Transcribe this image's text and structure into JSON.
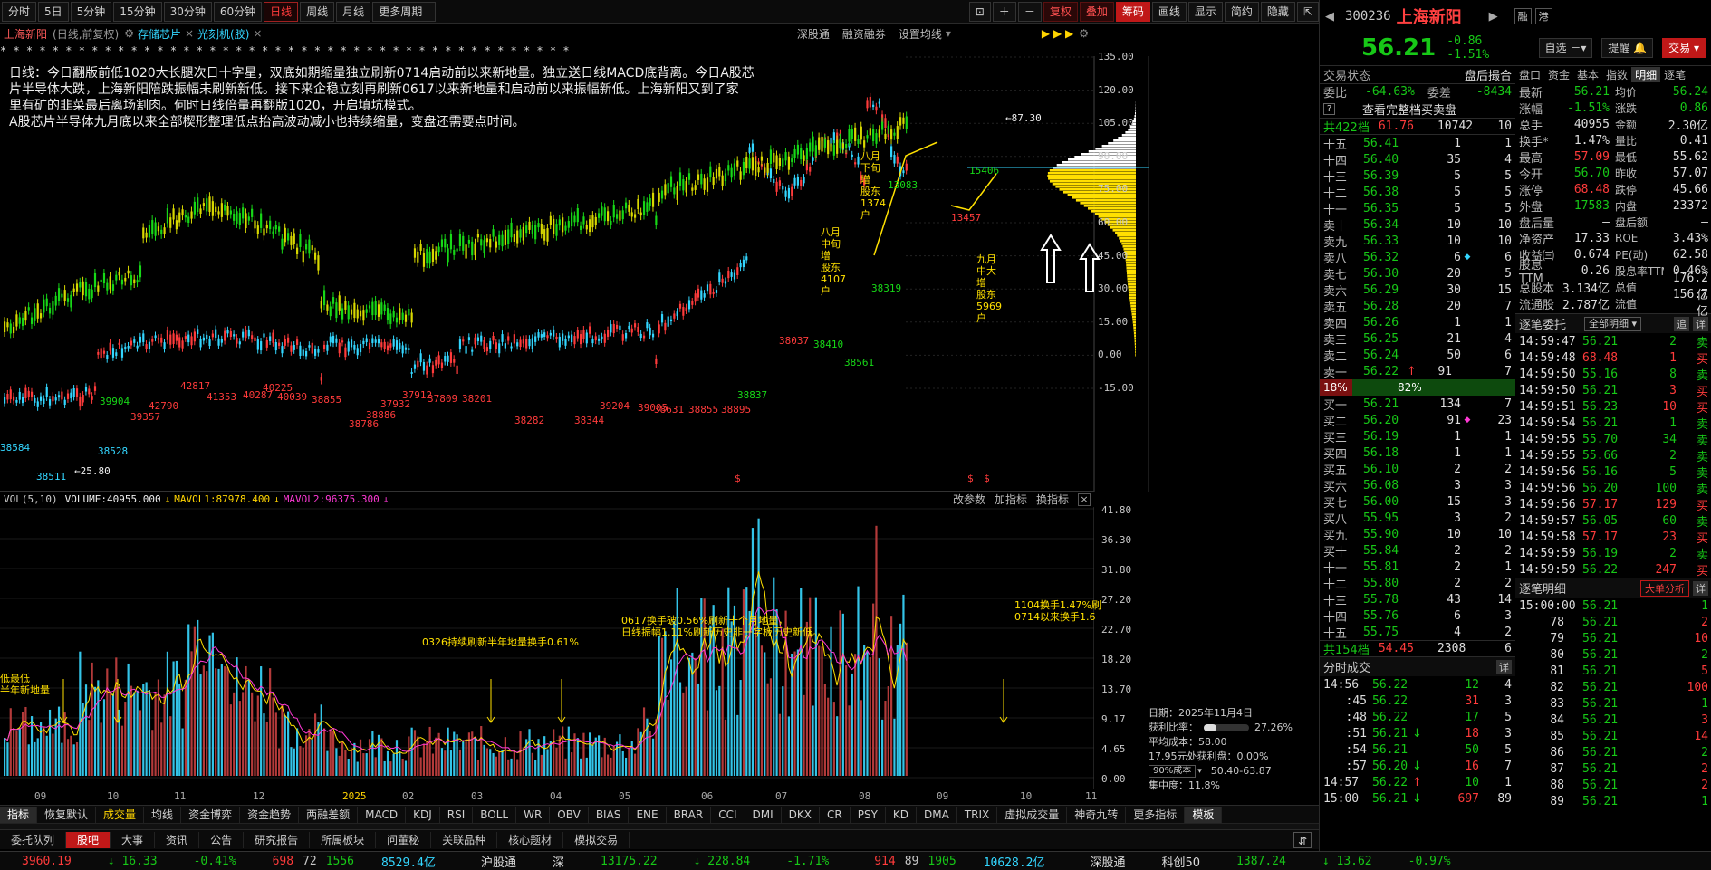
{
  "toolbar": {
    "periods": [
      "分时",
      "5日",
      "5分钟",
      "15分钟",
      "30分钟",
      "60分钟",
      "日线",
      "周线",
      "月线",
      "更多周期"
    ],
    "active_period": "日线",
    "right_buttons": [
      "复权",
      "叠加",
      "筹码",
      "画线",
      "显示",
      "简约",
      "隐藏"
    ]
  },
  "chart_header": {
    "name": "上海新阳",
    "mode": "(日线,前复权)",
    "tag1": "存储芯片",
    "tag2": "光刻机(胶)",
    "links": [
      "深股通",
      "融资融券",
      "设置均线"
    ]
  },
  "stars": "*     *         *         *         *       *       *         *       *       *       *       *      * * * *   *       *         *    * *       *   *  *     * *    *  *   *   *    *       *  *   * *   * *  *    *   *  *    * *   *",
  "annotation": [
    "日线：今日翻版前低1020大长腿次日十字星，双底如期缩量独立刷新0714启动前以来新地量。独立送日线MACD底背离。今日A股芯",
    "片半导体大跌，上海新阳陪跌振幅未刷新新低。接下来企稳立刻再刷新0617以来新地量和启动前以来振幅新低。上海新阳又到了家",
    "里有矿的韭菜最后离场割肉。何时日线倍量再翻版1020，开启填坑模式。",
    "A股芯片半导体九月底以来全部楔形整理低点抬高波动减小也持续缩量，变盘还需要点时间。"
  ],
  "price_axis": [
    "135.00",
    "120.00",
    "105.00",
    "90.00",
    "75.00",
    "60.00",
    "45.00",
    "30.00",
    "15.00",
    "0.00",
    "-15.00"
  ],
  "vol_axis": [
    "41.80",
    "36.30",
    "31.80",
    "27.20",
    "22.70",
    "18.20",
    "13.70",
    "9.17",
    "4.65",
    "0.00"
  ],
  "months": [
    "09",
    "10",
    "11",
    "12",
    "2025",
    "02",
    "03",
    "04",
    "05",
    "06",
    "07",
    "08",
    "09",
    "10",
    "11"
  ],
  "chart_labels": {
    "low_labels": [
      "38584",
      "38528",
      "38511",
      "39357",
      "39904",
      "42790",
      "42817",
      "41353",
      "40287",
      "40225",
      "40039",
      "38855",
      "38786",
      "38886",
      "37932",
      "37912",
      "37809",
      "38201",
      "38282",
      "38344",
      "39204",
      "39005",
      "38631",
      "38855",
      "38895",
      "38837",
      "38037",
      "38410",
      "38561",
      "38319"
    ],
    "low_mark": "←25.80",
    "high_mark": "←87.30",
    "callout1": [
      "八月下旬增",
      "股东1374户"
    ],
    "callout2": [
      "八月中旬增",
      "股东4107户"
    ],
    "callout3": [
      "九月中大增",
      "股东5969户"
    ],
    "callout4": "15406",
    "callout5": "13083",
    "callout6": "13457"
  },
  "vol_header": {
    "label": "VOL(5,10)",
    "volume": "VOLUME:40955.000",
    "mavol1": "MAVOL1:87978.400",
    "mavol2": "MAVOL2:96375.300",
    "links": [
      "改参数",
      "加指标",
      "换指标"
    ]
  },
  "vol_notes": {
    "n1": "0326持续刷新半年地量换手0.61%",
    "n2a": "0617换手破0.56%刷新十个月地量，",
    "n2b": "日线振幅1.11%刷新历史非一字板历史新低。",
    "n3a": "1104换手1.47%刷",
    "n3b": "0714以来换手1.6",
    "n4a": "低最低",
    "n4b": "半年新地量"
  },
  "chip_panel": {
    "date": "日期：2025年11月4日",
    "profit_label": "获利比率：",
    "profit_value": "27.26%",
    "avg": "平均成本：58.00",
    "prof2": "17.95元处获利盘：0.00%",
    "cost_sel": "90%成本",
    "cost_range": "50.40-63.87",
    "conc": "集中度：11.8%"
  },
  "indicator_tabs": [
    "指标",
    "恢复默认",
    "成交量",
    "均线",
    "资金博弈",
    "资金趋势",
    "两融差额",
    "MACD",
    "KDJ",
    "RSI",
    "BOLL",
    "WR",
    "OBV",
    "BIAS",
    "ENE",
    "BRAR",
    "CCI",
    "DMI",
    "DKX",
    "CR",
    "PSY",
    "KD",
    "DMA",
    "TRIX",
    "虚拟成交量",
    "神奇九转",
    "更多指标",
    "模板"
  ],
  "bottom_tabs": [
    "委托队列",
    "股吧",
    "大事",
    "资讯",
    "公告",
    "研究报告",
    "所属板块",
    "问董秘",
    "关联品种",
    "核心题材",
    "模拟交易"
  ],
  "status_bar": {
    "sh_index": "3960.19",
    "sh_chg": "↓ 16.33",
    "sh_pct": "-0.41%",
    "sh_updown": "698",
    "sh_flat": "72",
    "sh_up": "1556",
    "sh_amount": "8529.4亿",
    "hgt": "沪股通",
    "sz_label": "深",
    "sz_index": "13175.22",
    "sz_chg": "↓ 228.84",
    "sz_pct": "-1.71%",
    "sz_updown": "914",
    "sz_flat": "89",
    "sz_up": "1905",
    "sz_amount": "10628.2亿",
    "sgt": "深股通",
    "kc_label": "科创50",
    "kc_index": "1387.24",
    "kc_chg": "↓ 13.62",
    "kc_pct": "-0.97%"
  },
  "quote": {
    "code": "300236",
    "name": "上海新阳",
    "btn1": "融",
    "btn2": "港",
    "price": "56.21",
    "change": "-0.86",
    "pct": "-1.51%",
    "btn_watch": "自选",
    "btn_alert": "提醒",
    "btn_trade": "交易"
  },
  "right_tabs": [
    "盘口",
    "资金",
    "基本",
    "指数",
    "明细",
    "逐笔"
  ],
  "trade_state": "交易状态",
  "after_hours": "盘后撮合",
  "wei": {
    "label": "委比",
    "value": "-64.63%",
    "label2": "委差",
    "value2": "-8434"
  },
  "full_queue_btn": "查看完整档买卖盘",
  "total_sell": {
    "label": "共422档",
    "price": "61.76",
    "vol": "10742",
    "n": "10"
  },
  "sells": [
    [
      "十五",
      "56.41",
      "1",
      "1"
    ],
    [
      "十四",
      "56.40",
      "35",
      "4"
    ],
    [
      "十三",
      "56.39",
      "5",
      "5"
    ],
    [
      "十二",
      "56.38",
      "5",
      "5"
    ],
    [
      "十一",
      "56.35",
      "5",
      "5"
    ],
    [
      "卖十",
      "56.34",
      "10",
      "10"
    ],
    [
      "卖九",
      "56.33",
      "10",
      "10"
    ],
    [
      "卖八",
      "56.32",
      "6",
      "6"
    ],
    [
      "卖七",
      "56.30",
      "20",
      "5"
    ],
    [
      "卖六",
      "56.29",
      "30",
      "15"
    ],
    [
      "卖五",
      "56.28",
      "20",
      "7"
    ],
    [
      "卖四",
      "56.26",
      "1",
      "1"
    ],
    [
      "卖三",
      "56.25",
      "21",
      "4"
    ],
    [
      "卖二",
      "56.24",
      "50",
      "6"
    ],
    [
      "卖一",
      "56.22",
      "91",
      "7"
    ]
  ],
  "ratio": {
    "left": "18%",
    "right": "82%"
  },
  "buys": [
    [
      "买一",
      "56.21",
      "134",
      "7"
    ],
    [
      "买二",
      "56.20",
      "91",
      "23"
    ],
    [
      "买三",
      "56.19",
      "1",
      "1"
    ],
    [
      "买四",
      "56.18",
      "1",
      "1"
    ],
    [
      "买五",
      "56.10",
      "2",
      "2"
    ],
    [
      "买六",
      "56.08",
      "3",
      "3"
    ],
    [
      "买七",
      "56.00",
      "15",
      "3"
    ],
    [
      "买八",
      "55.95",
      "3",
      "2"
    ],
    [
      "买九",
      "55.90",
      "10",
      "10"
    ],
    [
      "买十",
      "55.84",
      "2",
      "2"
    ],
    [
      "十一",
      "55.81",
      "2",
      "1"
    ],
    [
      "十二",
      "55.80",
      "2",
      "2"
    ],
    [
      "十三",
      "55.78",
      "43",
      "14"
    ],
    [
      "十四",
      "55.76",
      "6",
      "3"
    ],
    [
      "十五",
      "55.75",
      "4",
      "2"
    ]
  ],
  "total_buy": {
    "label": "共154档",
    "price": "54.45",
    "vol": "2308",
    "n": "6"
  },
  "stats": [
    [
      "最新",
      "56.21",
      "均价",
      "56.24"
    ],
    [
      "涨幅",
      "-1.51%",
      "涨跌",
      "0.86"
    ],
    [
      "总手",
      "40955",
      "金额",
      "2.30亿"
    ],
    [
      "换手*",
      "1.47%",
      "量比",
      "0.41"
    ],
    [
      "最高",
      "57.09",
      "最低",
      "55.62"
    ],
    [
      "今开",
      "56.70",
      "昨收",
      "57.07"
    ],
    [
      "涨停",
      "68.48",
      "跌停",
      "45.66"
    ],
    [
      "外盘",
      "17583",
      "内盘",
      "23372"
    ],
    [
      "盘后量",
      "—",
      "盘后额",
      "—"
    ],
    [
      "净资产",
      "17.33",
      "ROE",
      "3.43%"
    ],
    [
      "收益㈢",
      "0.674",
      "PE(动)",
      "62.58"
    ],
    [
      "股息TTM",
      "0.26",
      "股息率TTM",
      "0.46%"
    ],
    [
      "总股本",
      "3.134亿",
      "总值",
      "176.2亿"
    ],
    [
      "流通股",
      "2.787亿",
      "流值",
      "156.7亿"
    ]
  ],
  "tick_entrust": {
    "title": "逐笔委托",
    "dropdown": "全部明细",
    "btn1": "追",
    "btn2": "详"
  },
  "tick_entrust_rows": [
    [
      "14:59:47",
      "56.21",
      "2",
      "卖"
    ],
    [
      "14:59:48",
      "68.48",
      "1",
      "买"
    ],
    [
      "14:59:50",
      "55.16",
      "8",
      "卖"
    ],
    [
      "14:59:50",
      "56.21",
      "3",
      "买"
    ],
    [
      "14:59:51",
      "56.23",
      "10",
      "买"
    ],
    [
      "14:59:54",
      "56.21",
      "1",
      "卖"
    ],
    [
      "14:59:55",
      "55.70",
      "34",
      "卖"
    ],
    [
      "14:59:55",
      "55.66",
      "2",
      "卖"
    ],
    [
      "14:59:56",
      "56.16",
      "5",
      "卖"
    ],
    [
      "14:59:56",
      "56.20",
      "100",
      "卖"
    ],
    [
      "14:59:56",
      "57.17",
      "129",
      "买"
    ],
    [
      "14:59:57",
      "56.05",
      "60",
      "卖"
    ],
    [
      "14:59:58",
      "57.17",
      "23",
      "买"
    ],
    [
      "14:59:59",
      "56.19",
      "2",
      "卖"
    ],
    [
      "14:59:59",
      "56.22",
      "247",
      "买"
    ]
  ],
  "tick_detail": {
    "title": "逐笔明细",
    "btn": "大单分析",
    "btn2": "详"
  },
  "tick_detail_rows": [
    [
      "15:00:00",
      "56.21",
      "1"
    ],
    [
      "78",
      "56.21",
      "2"
    ],
    [
      "79",
      "56.21",
      "10"
    ],
    [
      "80",
      "56.21",
      "2"
    ],
    [
      "81",
      "56.21",
      "5"
    ],
    [
      "82",
      "56.21",
      "100"
    ],
    [
      "83",
      "56.21",
      "1"
    ],
    [
      "84",
      "56.21",
      "3"
    ],
    [
      "85",
      "56.21",
      "14"
    ],
    [
      "86",
      "56.21",
      "2"
    ],
    [
      "87",
      "56.21",
      "2"
    ],
    [
      "88",
      "56.21",
      "2"
    ],
    [
      "89",
      "56.21",
      "1"
    ]
  ],
  "minute_trade": {
    "title": "分时成交",
    "btn": "详"
  },
  "minute_rows": [
    [
      "14:56",
      "56.22",
      "",
      "12",
      "4"
    ],
    [
      ":45",
      "56.22",
      "",
      "31",
      "3"
    ],
    [
      ":48",
      "56.22",
      "",
      "17",
      "5"
    ],
    [
      ":51",
      "56.21",
      "↓",
      "18",
      "3"
    ],
    [
      ":54",
      "56.21",
      "",
      "50",
      "5"
    ],
    [
      ":57",
      "56.20",
      "↓",
      "16",
      "7"
    ],
    [
      "14:57",
      "56.22",
      "↑",
      "10",
      "1"
    ],
    [
      "15:00",
      "56.21",
      "↓",
      "697",
      "89"
    ]
  ]
}
